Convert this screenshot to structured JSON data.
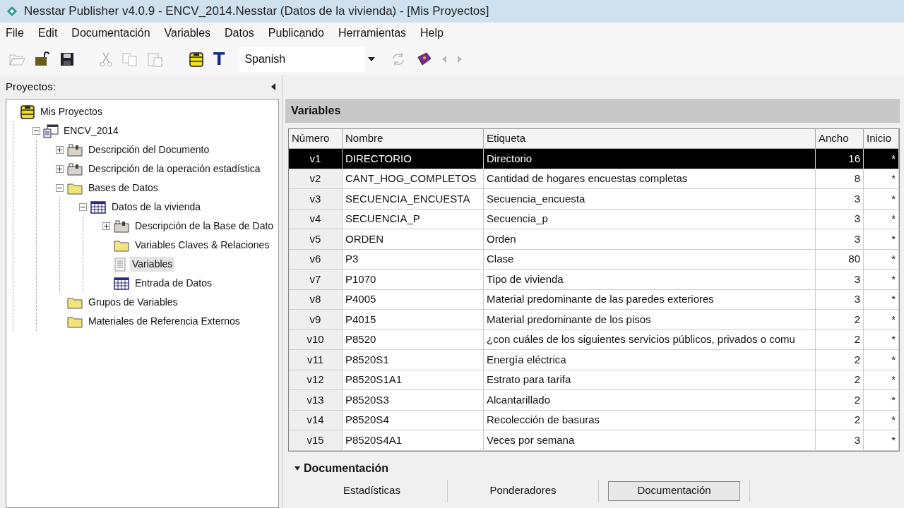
{
  "window": {
    "title": "Nesstar Publisher v4.0.9 - ENCV_2014.Nesstar (Datos de la vivienda) - [Mis Proyectos]"
  },
  "menu": [
    "File",
    "Edit",
    "Documentación",
    "Variables",
    "Datos",
    "Publicando",
    "Herramientas",
    "Help"
  ],
  "toolbar": [
    {
      "kind": "open",
      "disabled": true
    },
    {
      "kind": "unlock",
      "disabled": false
    },
    {
      "kind": "save",
      "disabled": false
    },
    {
      "kind": "sep"
    },
    {
      "kind": "cut",
      "disabled": true
    },
    {
      "kind": "copy",
      "disabled": true
    },
    {
      "kind": "paste",
      "disabled": true
    },
    {
      "kind": "sep"
    },
    {
      "kind": "database",
      "disabled": false
    },
    {
      "kind": "text",
      "label": "T",
      "disabled": false
    },
    {
      "kind": "language",
      "value": "Spanish"
    },
    {
      "kind": "refresh",
      "disabled": true
    },
    {
      "kind": "book",
      "disabled": false
    },
    {
      "kind": "prev",
      "disabled": true
    },
    {
      "kind": "next",
      "disabled": true
    }
  ],
  "projects": {
    "label": "Proyectos:",
    "tree": [
      {
        "label": "Mis Proyectos",
        "kind": "database",
        "selected": false,
        "children": [
          {
            "label": "ENCV_2014",
            "kind": "study",
            "selected": false,
            "expanded": true,
            "children": [
              {
                "label": "Descripción del Documento",
                "kind": "docfolder",
                "selected": false,
                "expanded": false
              },
              {
                "label": "Descripción de la operación estadística",
                "kind": "docfolder",
                "selected": false,
                "expanded": false
              },
              {
                "label": "Bases de Datos",
                "kind": "folder",
                "selected": false,
                "expanded": true,
                "children": [
                  {
                    "label": "Datos de la vivienda",
                    "kind": "table",
                    "selected": false,
                    "expanded": true,
                    "children": [
                      {
                        "label": "Descripción de la Base de Dato",
                        "kind": "docfolder",
                        "selected": false,
                        "expanded": false
                      },
                      {
                        "label": "Variables Claves & Relaciones",
                        "kind": "folder",
                        "selected": false
                      },
                      {
                        "label": "Variables",
                        "kind": "list",
                        "selected": true
                      },
                      {
                        "label": "Entrada de Datos",
                        "kind": "table",
                        "selected": false
                      }
                    ]
                  }
                ]
              },
              {
                "label": "Grupos de Variables",
                "kind": "folder",
                "selected": false
              },
              {
                "label": "Materiales de Referencia Externos",
                "kind": "folder",
                "selected": false
              }
            ]
          }
        ]
      }
    ]
  },
  "variables": {
    "title": "Variables",
    "columns": [
      "Número",
      "Nombre",
      "Etiqueta",
      "Ancho",
      "Inicio"
    ],
    "rows": [
      {
        "cells": [
          "v1",
          "DIRECTORIO",
          "Directorio",
          "16",
          "*"
        ],
        "selected": true
      },
      {
        "cells": [
          "v2",
          "CANT_HOG_COMPLETOS",
          "Cantidad de hogares encuestas completas",
          "8",
          "*"
        ],
        "selected": false
      },
      {
        "cells": [
          "v3",
          "SECUENCIA_ENCUESTA",
          "Secuencia_encuesta",
          "3",
          "*"
        ],
        "selected": false
      },
      {
        "cells": [
          "v4",
          "SECUENCIA_P",
          "Secuencia_p",
          "3",
          "*"
        ],
        "selected": false
      },
      {
        "cells": [
          "v5",
          "ORDEN",
          "Orden",
          "3",
          "*"
        ],
        "selected": false
      },
      {
        "cells": [
          "v6",
          "P3",
          "Clase",
          "80",
          "*"
        ],
        "selected": false
      },
      {
        "cells": [
          "v7",
          "P1070",
          "Tipo de vivienda",
          "3",
          "*"
        ],
        "selected": false
      },
      {
        "cells": [
          "v8",
          "P4005",
          "Material predominante de las paredes exteriores",
          "3",
          "*"
        ],
        "selected": false
      },
      {
        "cells": [
          "v9",
          "P4015",
          "Material predominante de los pisos",
          "2",
          "*"
        ],
        "selected": false
      },
      {
        "cells": [
          "v10",
          "P8520",
          "¿con cuáles de los siguientes servicios públicos, privados o comu",
          "2",
          "*"
        ],
        "selected": false
      },
      {
        "cells": [
          "v11",
          "P8520S1",
          "Energía eléctrica",
          "2",
          "*"
        ],
        "selected": false
      },
      {
        "cells": [
          "v12",
          "P8520S1A1",
          "Estrato para tarifa",
          "2",
          "*"
        ],
        "selected": false
      },
      {
        "cells": [
          "v13",
          "P8520S3",
          "Alcantarillado",
          "2",
          "*"
        ],
        "selected": false
      },
      {
        "cells": [
          "v14",
          "P8520S4",
          "Recolección de basuras",
          "2",
          "*"
        ],
        "selected": false
      },
      {
        "cells": [
          "v15",
          "P8520S4A1",
          "Veces por semana",
          "3",
          "*"
        ],
        "selected": false
      }
    ]
  },
  "documentation": {
    "title": "Documentación",
    "expanded": true,
    "tabs": [
      {
        "label": "Estadísticas",
        "selected": false
      },
      {
        "label": "Ponderadores",
        "selected": false
      },
      {
        "label": "Documentación",
        "selected": true
      }
    ]
  }
}
